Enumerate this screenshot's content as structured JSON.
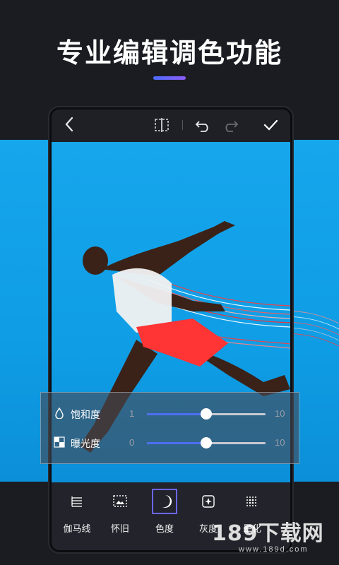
{
  "headline": "专业编辑调色功能",
  "colors": {
    "accent": "#4e6ef2",
    "active_border": "#6b66f2",
    "photo_sky": "#0f9ee6",
    "trail_red": "#ff3b3b"
  },
  "editor_toolbar": {
    "back_icon": "chevron-left-icon",
    "compare_icon": "compare-split-icon",
    "undo_icon": "undo-icon",
    "redo_icon": "redo-icon",
    "confirm_icon": "check-icon"
  },
  "adjust_panel": {
    "rows": [
      {
        "label": "饱和度",
        "icon": "droplet-icon",
        "min": "1",
        "max": "10",
        "value_fraction": 0.5
      },
      {
        "label": "曝光度",
        "icon": "checker-exposure-icon",
        "min": "0",
        "max": "10",
        "value_fraction": 0.5
      }
    ]
  },
  "tools": [
    {
      "label": "伽马线",
      "icon": "gamma-lines-icon",
      "active": false
    },
    {
      "label": "怀旧",
      "icon": "photo-frame-icon",
      "active": false
    },
    {
      "label": "色度",
      "icon": "moon-icon",
      "active": true
    },
    {
      "label": "灰度",
      "icon": "sparkle-square-icon",
      "active": false
    },
    {
      "label": "晕化",
      "icon": "dot-grid-icon",
      "active": false
    }
  ],
  "watermark": {
    "text": "189下载网",
    "url": "www.189d.com"
  }
}
